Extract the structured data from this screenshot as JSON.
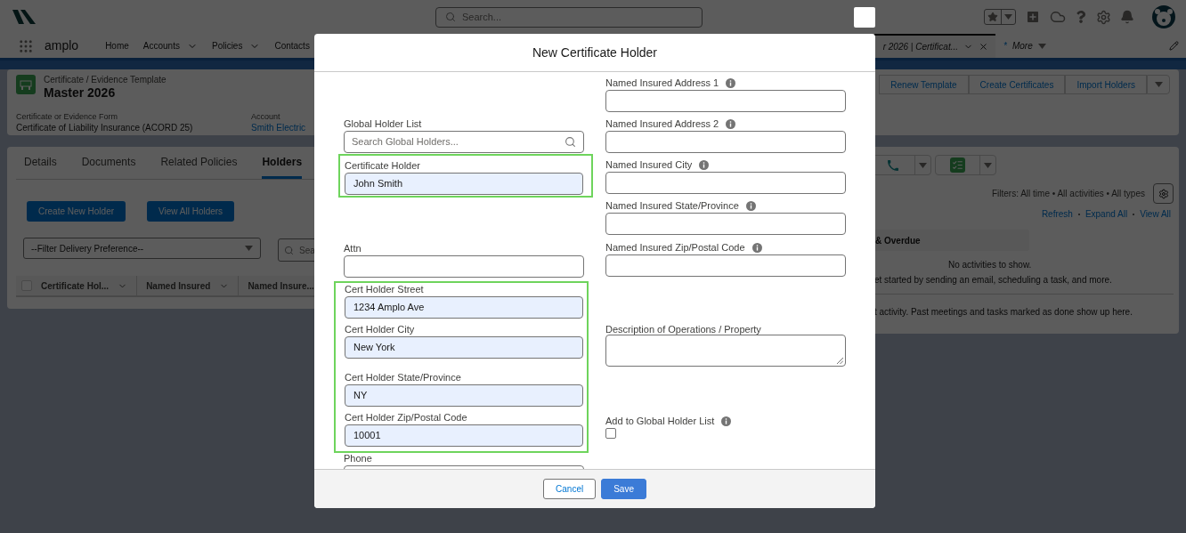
{
  "header": {
    "search_placeholder": "Search..."
  },
  "nav": {
    "app_name": "amplo",
    "items": [
      {
        "label": "Home",
        "has_menu": false
      },
      {
        "label": "Accounts",
        "has_menu": true
      },
      {
        "label": "Policies",
        "has_menu": true
      },
      {
        "label": "Contacts",
        "has_menu": false
      }
    ],
    "open_tab": {
      "label": "r 2026 | Certificat..."
    },
    "more": {
      "marker": "*",
      "label": "More"
    }
  },
  "record": {
    "type": "Certificate / Evidence Template",
    "title": "Master 2026",
    "actions": [
      "Renew Template",
      "Create Certificates",
      "Import Holders"
    ],
    "fields": [
      {
        "label": "Certificate or Evidence Form",
        "value": "Certificate of Liability Insurance (ACORD 25)",
        "kind": "text"
      },
      {
        "label": "Account",
        "value": "Smith Electric",
        "kind": "link"
      }
    ]
  },
  "tabs": [
    {
      "label": "Details",
      "selected": false
    },
    {
      "label": "Documents",
      "selected": false
    },
    {
      "label": "Related Policies",
      "selected": false
    },
    {
      "label": "Holders",
      "selected": true
    }
  ],
  "holders": {
    "buttons": [
      "Create New Holder",
      "View All Holders"
    ],
    "filter_select": "--Filter Delivery Preference--",
    "search_placeholder": "Sea",
    "select_all": {
      "checked": false
    },
    "columns": [
      {
        "label": "Certificate Hol...",
        "has_menu": true
      },
      {
        "label": "Named Insured",
        "has_menu": true
      },
      {
        "label": "Named Insure...",
        "has_menu": false
      }
    ]
  },
  "activity": {
    "filters": "Filters: All time • All activities • All types",
    "links": [
      "Refresh",
      "Expand All",
      "View All"
    ],
    "section": "& Overdue",
    "empty_title": "No activities to show.",
    "empty_hint": "et started by sending an email, scheduling a task, and more.",
    "past_hint": "t activity. Past meetings and tasks marked as done show up here."
  },
  "modal": {
    "title": "New Certificate Holder",
    "left": [
      {
        "highlighted": false,
        "fields": [
          {
            "label": "Global Holder List",
            "kind": "search",
            "placeholder": "Search Global Holders..."
          }
        ]
      },
      {
        "highlighted": true,
        "fields": [
          {
            "label": "Certificate Holder",
            "kind": "input",
            "value": "John Smith"
          }
        ]
      },
      {
        "highlighted": false,
        "fields": [
          {
            "label": "Attn",
            "kind": "input"
          }
        ]
      },
      {
        "highlighted": true,
        "fields": [
          {
            "label": "Cert Holder Street",
            "kind": "input",
            "value": "1234 Amplo Ave"
          },
          {
            "label": "Cert Holder City",
            "kind": "input",
            "value": "New York"
          },
          {
            "label": "Cert Holder State/Province",
            "kind": "input",
            "value": "NY"
          },
          {
            "label": "Cert Holder Zip/Postal Code",
            "kind": "input",
            "value": "10001"
          }
        ]
      },
      {
        "highlighted": false,
        "fields": [
          {
            "label": "Phone",
            "kind": "input"
          }
        ]
      }
    ],
    "right": [
      {
        "label": "Named Insured Address 1",
        "kind": "input",
        "info": true
      },
      {
        "label": "Named Insured Address 2",
        "kind": "input",
        "info": true
      },
      {
        "label": "Named Insured City",
        "kind": "input",
        "info": true
      },
      {
        "label": "Named Insured State/Province",
        "kind": "input",
        "info": true
      },
      {
        "label": "Named Insured Zip/Postal Code",
        "kind": "input",
        "info": true
      },
      {
        "label": "Description of Operations / Property",
        "kind": "textarea",
        "info": false
      },
      {
        "label": "Add to Global Holder List",
        "kind": "checkbox",
        "checked": false,
        "info": true
      }
    ],
    "buttons": [
      {
        "label": "Cancel",
        "kind": "neutral"
      },
      {
        "label": "Save",
        "kind": "brand"
      }
    ]
  }
}
